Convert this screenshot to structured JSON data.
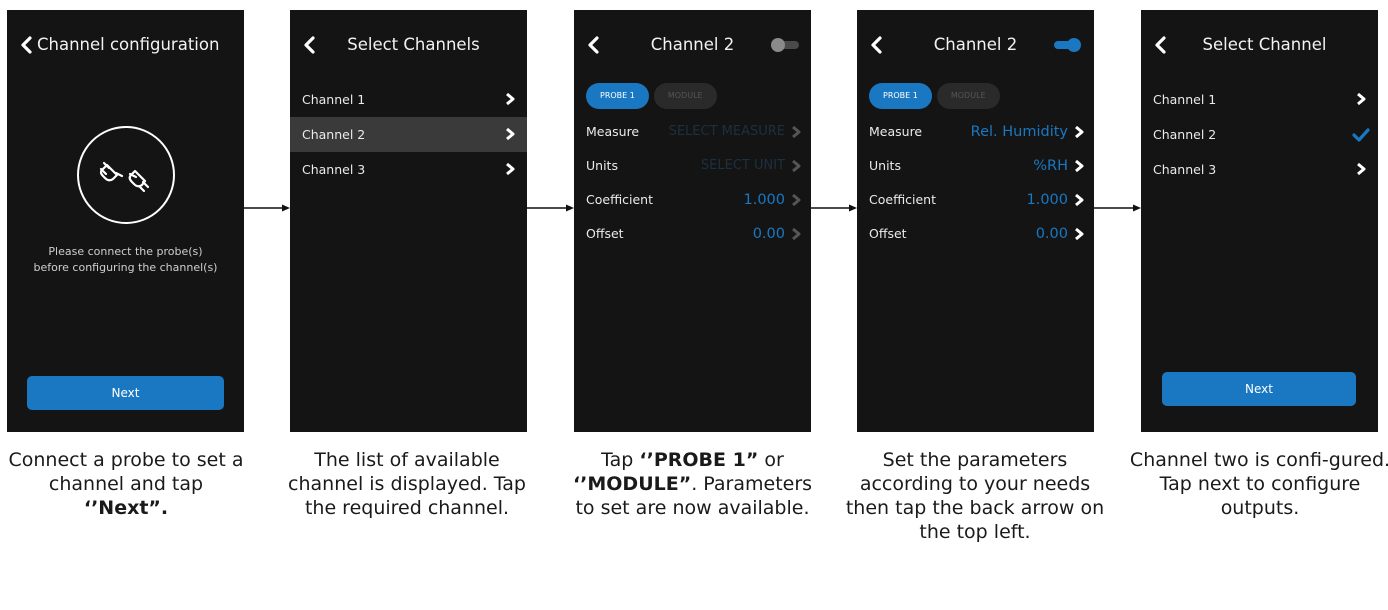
{
  "colors": {
    "accent": "#1a78c2",
    "screen_bg": "#141414",
    "selected_row": "#3a3a3a"
  },
  "screen1": {
    "title": "Channel configuration",
    "icon": "plug-connect-icon",
    "message_line1": "Please connect the probe(s)",
    "message_line2": "before configuring the channel(s)",
    "next_label": "Next",
    "caption_part1": "Connect a probe to set a channel and tap",
    "caption_bold": "‘’Next”."
  },
  "screen2": {
    "title": "Select Channels",
    "channels": [
      "Channel 1",
      "Channel 2",
      "Channel 3"
    ],
    "selected_index": 1,
    "caption": "The list of available channel is displayed. Tap the required channel."
  },
  "screen3": {
    "title": "Channel 2",
    "toggle_on": false,
    "tabs": [
      "PROBE 1",
      "MODULE"
    ],
    "params": [
      {
        "label": "Measure",
        "value": "SELECT MEASURE"
      },
      {
        "label": "Units",
        "value": "SELECT UNIT"
      },
      {
        "label": "Coefficient",
        "value": "1.000"
      },
      {
        "label": "Offset",
        "value": "0.00"
      }
    ],
    "caption_tap": "Tap",
    "caption_probe": "‘’PROBE 1”",
    "caption_or": "or",
    "caption_module": "‘’MODULE”",
    "caption_rest": ". Parameters to set are now available."
  },
  "screen4": {
    "title": "Channel 2",
    "toggle_on": true,
    "tabs": [
      "PROBE 1",
      "MODULE"
    ],
    "params": [
      {
        "label": "Measure",
        "value": "Rel. Humidity"
      },
      {
        "label": "Units",
        "value": "%RH"
      },
      {
        "label": "Coefficient",
        "value": "1.000"
      },
      {
        "label": "Offset",
        "value": "0.00"
      }
    ],
    "caption": "Set the parameters according to your needs then tap the back arrow on the top left."
  },
  "screen5": {
    "title": "Select Channel",
    "channels": [
      "Channel 1",
      "Channel 2",
      "Channel 3"
    ],
    "checked_index": 1,
    "next_label": "Next",
    "caption": "Channel two is confi-gured. Tap next to configure outputs."
  }
}
